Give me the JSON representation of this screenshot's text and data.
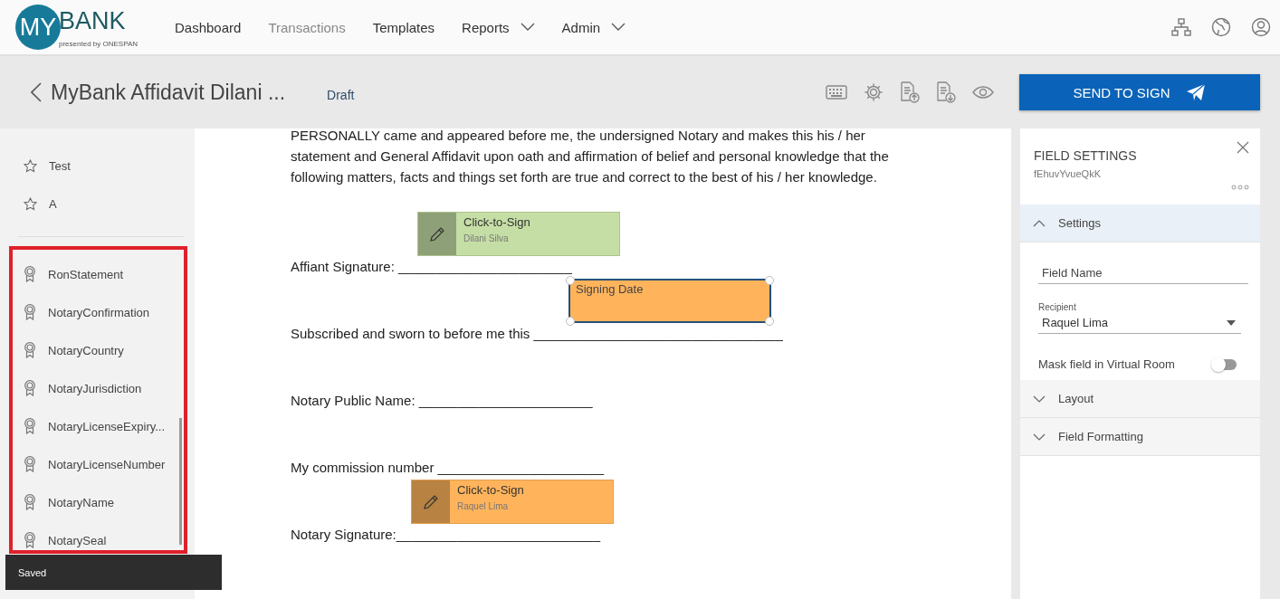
{
  "logo": {
    "text": "MY",
    "accent": "BANK",
    "tagline": "presented by ONESPAN"
  },
  "nav": [
    {
      "label": "Dashboard",
      "selected": false,
      "dropdown": false
    },
    {
      "label": "Transactions",
      "selected": true,
      "dropdown": false
    },
    {
      "label": "Templates",
      "selected": false,
      "dropdown": false
    },
    {
      "label": "Reports",
      "selected": false,
      "dropdown": true
    },
    {
      "label": "Admin",
      "selected": false,
      "dropdown": true
    }
  ],
  "transaction": {
    "title": "MyBank Affidavit Dilani ...",
    "status": "Draft",
    "send_button": "SEND TO SIGN"
  },
  "sidebar": {
    "favorites": [
      {
        "label": "Test"
      },
      {
        "label": "A"
      }
    ],
    "fields": [
      {
        "label": "RonStatement"
      },
      {
        "label": "NotaryConfirmation"
      },
      {
        "label": "NotaryCountry"
      },
      {
        "label": "NotaryJurisdiction"
      },
      {
        "label": "NotaryLicenseExpiry..."
      },
      {
        "label": "NotaryLicenseNumber"
      },
      {
        "label": "NotaryName"
      },
      {
        "label": "NotarySeal"
      }
    ]
  },
  "toast": "Saved",
  "document": {
    "paragraph": "PERSONALLY came and appeared before me, the undersigned Notary and makes this his / her statement and General Affidavit upon oath and affirmation of belief and personal knowledge that the following matters, facts and things set forth are true and correct to the best of his / her knowledge.",
    "lines": [
      {
        "text": "Affiant Signature: _______________________",
        "field": {
          "kind": "signature",
          "label": "Click-to-Sign",
          "signer": "Dilani Silva",
          "color": "#c5dea5",
          "selected": false
        }
      },
      {
        "text": "Subscribed and sworn to before me this _________________________________",
        "field": {
          "kind": "date",
          "label": "Signing Date",
          "color": "#ffb45c",
          "selected": true
        }
      },
      {
        "text": "Notary Public Name: _______________________"
      },
      {
        "text": "My commission number ______________________"
      },
      {
        "text": "Notary Signature:___________________________",
        "field": {
          "kind": "signature",
          "label": "Click-to-Sign",
          "signer": "Raquel Lima",
          "color": "#ffb45c",
          "selected": false
        }
      }
    ]
  },
  "field_settings": {
    "title": "FIELD SETTINGS",
    "id": "fEhuvYvueQkK",
    "sections": [
      {
        "label": "Settings",
        "expanded": true
      },
      {
        "label": "Layout",
        "expanded": false
      },
      {
        "label": "Field Formatting",
        "expanded": false
      }
    ],
    "field_name": {
      "placeholder": "Field Name"
    },
    "recipient": {
      "label": "Recipient",
      "value": "Raquel Lima"
    },
    "mask": {
      "label": "Mask field in Virtual Room",
      "on": false
    }
  }
}
